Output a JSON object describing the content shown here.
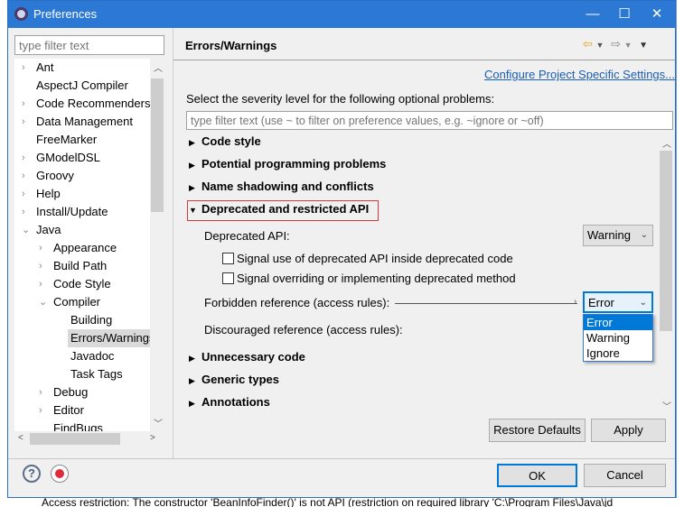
{
  "window": {
    "title": "Preferences",
    "minimize": "—",
    "maximize": "☐",
    "close": "✕"
  },
  "sidebar": {
    "filter_placeholder": "type filter text",
    "items": [
      {
        "label": "Ant",
        "expander": "›"
      },
      {
        "label": "AspectJ Compiler",
        "expander": ""
      },
      {
        "label": "Code Recommenders",
        "expander": "›"
      },
      {
        "label": "Data Management",
        "expander": "›"
      },
      {
        "label": "FreeMarker",
        "expander": ""
      },
      {
        "label": "GModelDSL",
        "expander": "›"
      },
      {
        "label": "Groovy",
        "expander": "›"
      },
      {
        "label": "Help",
        "expander": "›"
      },
      {
        "label": "Install/Update",
        "expander": "›"
      },
      {
        "label": "Java",
        "expander": "⌄"
      },
      {
        "label": "Appearance",
        "expander": "›"
      },
      {
        "label": "Build Path",
        "expander": "›"
      },
      {
        "label": "Code Style",
        "expander": "›"
      },
      {
        "label": "Compiler",
        "expander": "⌄"
      },
      {
        "label": "Building",
        "expander": ""
      },
      {
        "label": "Errors/Warnings",
        "expander": "",
        "selected": true
      },
      {
        "label": "Javadoc",
        "expander": ""
      },
      {
        "label": "Task Tags",
        "expander": ""
      },
      {
        "label": "Debug",
        "expander": "›"
      },
      {
        "label": "Editor",
        "expander": "›"
      },
      {
        "label": "FindBugs",
        "expander": ""
      }
    ]
  },
  "main": {
    "title": "Errors/Warnings",
    "configure_link": "Configure Project Specific Settings...",
    "instruction": "Select the severity level for the following optional problems:",
    "filter_placeholder": "type filter text (use ~ to filter on preference values, e.g. ~ignore or ~off)",
    "sections": {
      "code_style": "Code style",
      "potential": "Potential programming problems",
      "name_shadowing": "Name shadowing and conflicts",
      "deprecated": "Deprecated and restricted API",
      "unnecessary": "Unnecessary code",
      "generic": "Generic types",
      "annotations": "Annotations"
    },
    "deprecated_api_label": "Deprecated API:",
    "deprecated_api_value": "Warning",
    "checkbox1": {
      "label": "Signal use of deprecated API inside deprecated code",
      "checked": false
    },
    "checkbox2": {
      "label": "Signal overriding or implementing deprecated method",
      "checked": false
    },
    "forbidden_label": "Forbidden reference (access rules):",
    "forbidden_value": "Error",
    "discouraged_label": "Discouraged reference (access rules):",
    "dropdown_options": [
      "Error",
      "Warning",
      "Ignore"
    ],
    "dropdown_highlight": "Error",
    "restore_defaults": "Restore Defaults",
    "apply": "Apply"
  },
  "footer": {
    "ok": "OK",
    "cancel": "Cancel"
  },
  "background": {
    "status_text": "Access restriction: The constructor 'BeanInfoFinder()' is not API (restriction on required library 'C:\\Program Files\\Java\\jd"
  },
  "colors": {
    "titlebar": "#2b79d4",
    "link": "#1a5fb4",
    "highlight": "#0078d7",
    "section_outline": "#d9363e"
  }
}
